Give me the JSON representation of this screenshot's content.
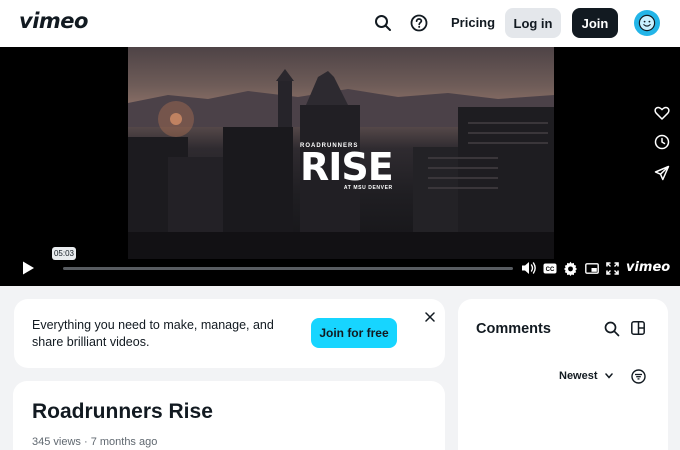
{
  "header": {
    "logo": "vimeo",
    "search_icon": "search-icon",
    "help_icon": "help-icon",
    "pricing_label": "Pricing",
    "login_label": "Log in",
    "join_label": "Join",
    "avatar_icon": "smiley-avatar-icon"
  },
  "player": {
    "frame_logo": {
      "top": "ROADRUNNERS",
      "main": "RISE",
      "bottom": "AT MSU DENVER"
    },
    "side_icons": [
      "heart-icon",
      "clock-icon",
      "send-icon"
    ],
    "hover_time": "05:03",
    "progress_fraction": 0.0,
    "controls": [
      "play-icon",
      "volume-icon",
      "cc-icon",
      "gear-icon",
      "pip-icon",
      "fullscreen-icon"
    ],
    "brand": "vimeo"
  },
  "promo": {
    "text": "Everything you need to make, manage, and share brilliant videos.",
    "button_label": "Join for free"
  },
  "video": {
    "title": "Roadrunners Rise",
    "meta": "345 views · 7 months ago"
  },
  "comments": {
    "title": "Comments",
    "sort_label": "Newest"
  },
  "colors": {
    "accent": "#17d5ff",
    "dark": "#121a21",
    "avatar": "#23b5e8"
  }
}
